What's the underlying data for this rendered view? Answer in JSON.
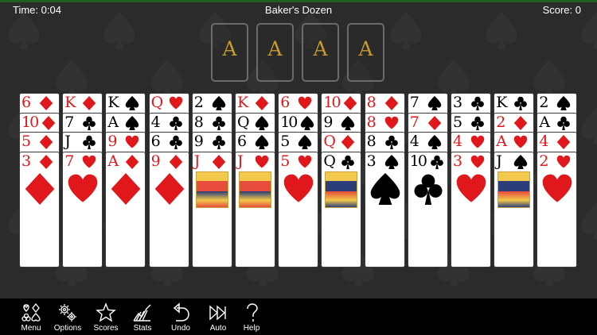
{
  "header": {
    "time": "Time: 0:04",
    "title": "Baker's Dozen",
    "score": "Score: 0"
  },
  "foundations": [
    "A",
    "A",
    "A",
    "A"
  ],
  "colors": {
    "red": "#e0181c",
    "black": "#000000",
    "gold": "#c89a2c",
    "felt": "#2d2d2d"
  },
  "tableau": [
    [
      "6♦",
      "10♦",
      "5♦",
      "3♦"
    ],
    [
      "K♦",
      "7♣",
      "J♣",
      "7♥"
    ],
    [
      "K♠",
      "A♠",
      "9♥",
      "A♦"
    ],
    [
      "Q♥",
      "4♣",
      "6♣",
      "9♦"
    ],
    [
      "2♠",
      "8♣",
      "9♣",
      "J♦"
    ],
    [
      "K♦",
      "Q♠",
      "6♠",
      "J♥"
    ],
    [
      "6♥",
      "10♠",
      "5♠",
      "5♥"
    ],
    [
      "10♦",
      "9♠",
      "Q♦",
      "Q♣"
    ],
    [
      "8♦",
      "8♥",
      "8♣",
      "3♠"
    ],
    [
      "7♠",
      "7♦",
      "4♠",
      "10♣"
    ],
    [
      "3♣",
      "5♣",
      "4♥",
      "3♥"
    ],
    [
      "K♣",
      "2♦",
      "A♥",
      "J♠"
    ],
    [
      "2♠",
      "A♣",
      "4♦",
      "2♥"
    ]
  ],
  "toolbar": [
    {
      "label": "Menu",
      "icon": "card-suits-icon"
    },
    {
      "label": "Options",
      "icon": "gears-icon"
    },
    {
      "label": "Scores",
      "icon": "star-icon"
    },
    {
      "label": "Stats",
      "icon": "chart-icon"
    },
    {
      "label": "Undo",
      "icon": "undo-icon"
    },
    {
      "label": "Auto",
      "icon": "fast-forward-icon"
    },
    {
      "label": "Help",
      "icon": "question-icon"
    }
  ]
}
